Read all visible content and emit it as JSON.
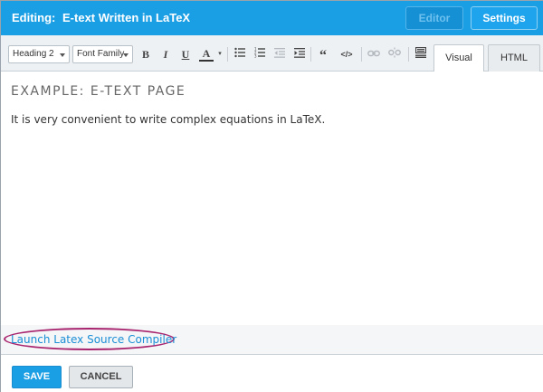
{
  "header": {
    "title_prefix": "Editing:",
    "title": "E-text Written in LaTeX",
    "editor_label": "Editor",
    "settings_label": "Settings"
  },
  "toolbar": {
    "block_format": "Heading 2",
    "font_family": "Font Family",
    "buttons": {
      "bold": "B",
      "italic": "I",
      "underline": "U",
      "font_color": "A",
      "quote": "“",
      "code": "</>"
    },
    "tabs": [
      "Visual",
      "HTML"
    ]
  },
  "content": {
    "heading": "EXAMPLE: E-TEXT PAGE",
    "paragraph": "It is very convenient to write complex equations in LaTeX."
  },
  "compiler_link": "Launch Latex Source Compiler",
  "footer": {
    "save_label": "SAVE",
    "cancel_label": "CANCEL"
  },
  "colors": {
    "header_bg": "#1a9ee4",
    "link": "#1a8ed6",
    "highlight_oval": "#a8246e",
    "save_bg": "#1a9ee4"
  }
}
